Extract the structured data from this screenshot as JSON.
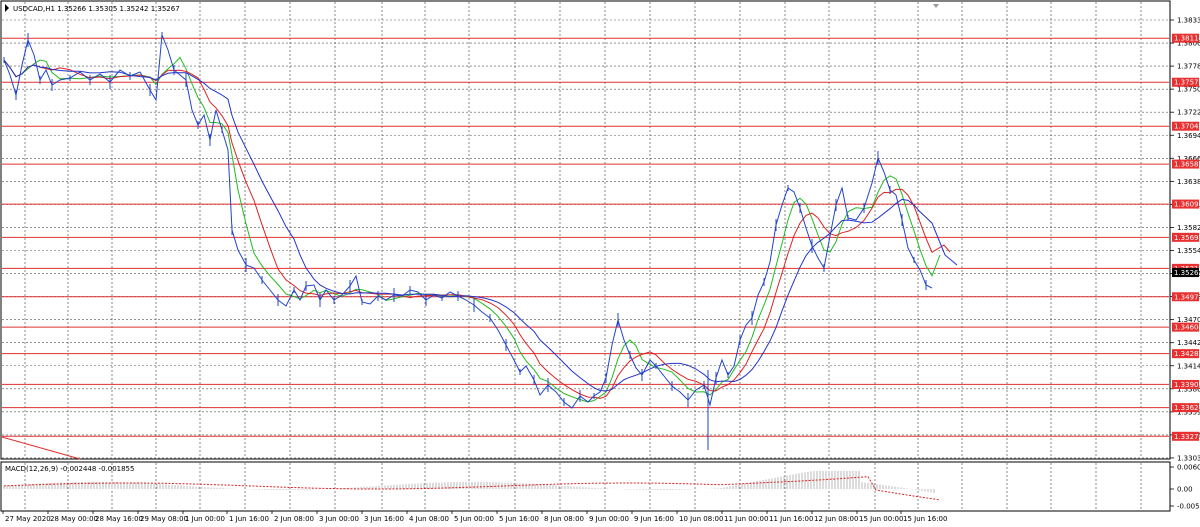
{
  "main_chart": {
    "header": "USDCAD,H1  1.35266 1.35305 1.35242 1.35267",
    "scale_labels": [
      "1.38335",
      "1.38060",
      "1.37780",
      "1.37500",
      "1.37220",
      "1.36940",
      "1.36660",
      "1.36380",
      "1.36100",
      "1.35825",
      "1.35545",
      "1.35267",
      "1.34985",
      "1.34705",
      "1.34425",
      "1.34145",
      "1.33865",
      "1.33590",
      "1.33310",
      "1.33030"
    ],
    "levels": [
      "1.38114",
      "1.37579",
      "1.37045",
      "1.36585",
      "1.36099",
      "1.35695",
      "1.35318",
      "1.34973",
      "1.34604",
      "1.34282",
      "1.33908",
      "1.33626",
      "1.33278"
    ],
    "current_price": "1.35267",
    "time_labels": [
      "27 May 2020",
      "28 May 00:00",
      "28 May 16:00",
      "29 May 08:00",
      "1 Jun 00:00",
      "1 Jun 16:00",
      "2 Jun 08:00",
      "3 Jun 00:00",
      "3 Jun 16:00",
      "4 Jun 08:00",
      "5 Jun 00:00",
      "5 Jun 16:00",
      "8 Jun 08:00",
      "9 Jun 00:00",
      "9 Jun 16:00",
      "10 Jun 08:00",
      "11 Jun 00:00",
      "11 Jun 16:00",
      "12 Jun 08:00",
      "15 Jun 00:00",
      "15 Jun 16:00"
    ]
  },
  "macd": {
    "header": "MACD(12,26,9) -0.002448 -0.001855",
    "scale_labels": [
      "0.006051",
      "0.00",
      "-0.0050"
    ]
  },
  "colors": {
    "price": "#2244cc",
    "ma_fast": "#22bb22",
    "ma_mid": "#dd2222",
    "ma_slow": "#2233cc",
    "level_line": "#e03030",
    "level_label_bg": "#e83030",
    "current_label_bg": "#000000",
    "grid": "#555555",
    "histogram": "#b8b8b8",
    "signal": "#dd2222"
  }
}
